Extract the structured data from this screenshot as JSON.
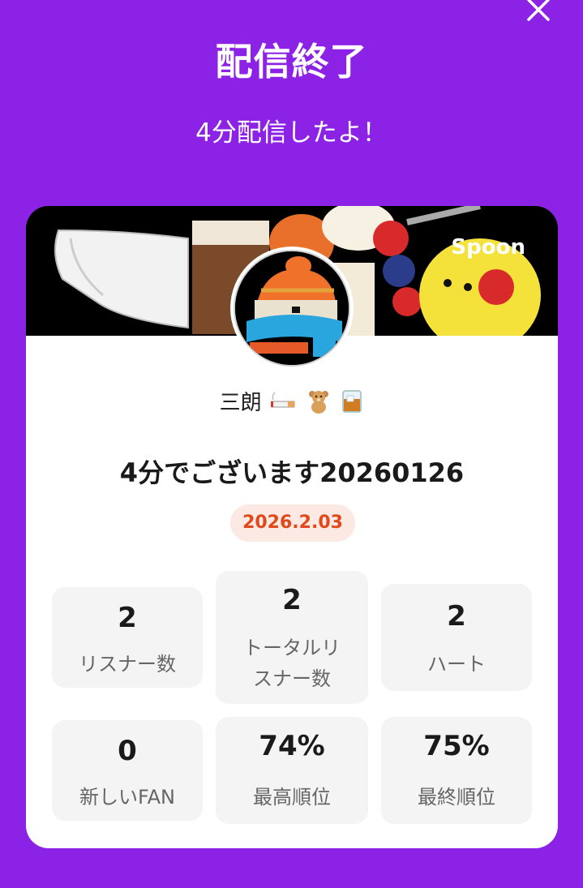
{
  "header": {
    "title": "配信終了",
    "subtitle": "4分配信したよ！"
  },
  "card": {
    "brand": "Spoon",
    "username": "三朗",
    "username_emojis": [
      "cigarette",
      "teddy-bear",
      "whisky-glass"
    ],
    "live_title": "4分でございます20260126",
    "date": "2026.2.03",
    "stats": [
      {
        "value": "2",
        "label": "リスナー数"
      },
      {
        "value": "2",
        "label": "トータルリ\nスナー数"
      },
      {
        "value": "2",
        "label": "ハート"
      },
      {
        "value": "0",
        "label": "新しいFAN"
      },
      {
        "value": "74%",
        "label": "最高順位"
      },
      {
        "value": "75%",
        "label": "最終順位"
      }
    ]
  },
  "colors": {
    "background": "#8c22e6",
    "card": "#ffffff",
    "date_badge_bg": "#fde9e3",
    "date_badge_text": "#e04a1a",
    "stat_bg": "#f4f4f4"
  },
  "icons": {
    "close": "close-icon"
  }
}
